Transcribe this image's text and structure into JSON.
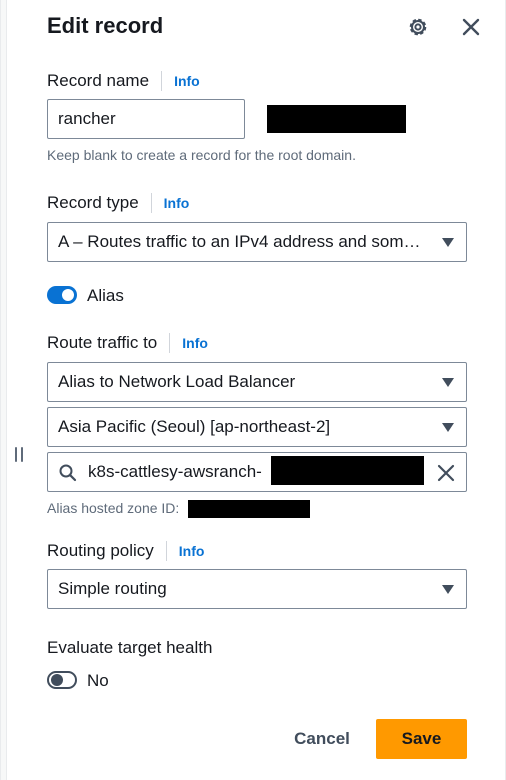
{
  "header": {
    "title": "Edit record",
    "settings_icon": "gear-icon",
    "close_icon": "close-icon"
  },
  "record_name": {
    "label": "Record name",
    "info": "Info",
    "value": "rancher",
    "hint": "Keep blank to create a record for the root domain."
  },
  "record_type": {
    "label": "Record type",
    "info": "Info",
    "value": "A – Routes traffic to an IPv4 address and some AWS resources"
  },
  "alias": {
    "label": "Alias",
    "enabled": true
  },
  "route_traffic": {
    "label": "Route traffic to",
    "info": "Info",
    "endpoint": "Alias to Network Load Balancer",
    "region": "Asia Pacific (Seoul) [ap-northeast-2]",
    "target_value": "k8s-cattlesy-awsranch-",
    "zone_id_label": "Alias hosted zone ID:"
  },
  "routing_policy": {
    "label": "Routing policy",
    "info": "Info",
    "value": "Simple routing"
  },
  "health": {
    "label": "Evaluate target health",
    "state_label": "No",
    "enabled": false
  },
  "actions": {
    "cancel": "Cancel",
    "save": "Save"
  },
  "colors": {
    "accent": "#0972d3",
    "save_button": "#ff9900"
  }
}
